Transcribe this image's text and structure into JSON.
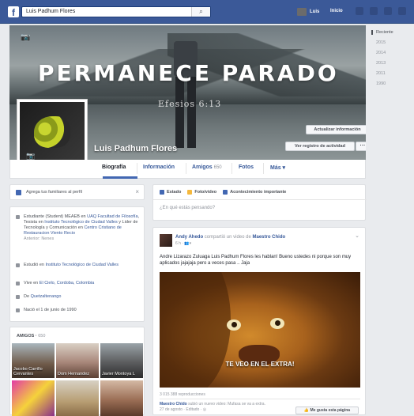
{
  "topbar": {
    "search_value": "Luis Padhum Flores",
    "user_name": "Luis",
    "home_label": "Inicio"
  },
  "cover": {
    "title": "PERMANECE PARADO",
    "subtitle": "Efesios 6:13",
    "update_info": "Actualizar información",
    "activity_log": "Ver registro de actividad",
    "more": "···"
  },
  "profile": {
    "name": "Luis Padhum Flores"
  },
  "nav": {
    "biografia": "Biografía",
    "informacion": "Información",
    "amigos": "Amigos",
    "amigos_count": "650",
    "fotos": "Fotos",
    "mas": "Más ▾"
  },
  "years": [
    "Reciente",
    "2015",
    "2014",
    "2013",
    "2011",
    "1990"
  ],
  "add_family": {
    "label": "Agrega tus familiares al perfil"
  },
  "intro": {
    "work": {
      "prefix": "Estudiante (Student) MEAEB en ",
      "link1": "UAQ Facultad de Filosofía",
      "mid": ", Tesista en ",
      "link2": "Instituto Tecnológico de Ciudad Valles",
      "mid2": " y Lider de Tecnología y Comunicación en ",
      "link3": "Centro Cristiano de Restauracion Viento Recio",
      "previous": "Anterior: Nenes"
    },
    "study": {
      "prefix": "Estudió en ",
      "link": "Instituto Tecnológico de Ciudad Valles"
    },
    "lives": {
      "prefix": "Vive en ",
      "link": "El Cielo, Cordoba, Colombia"
    },
    "from": {
      "prefix": "De ",
      "link": "Quetzaltenango"
    },
    "born": "Nació el 1 de junio de 1990"
  },
  "friends": {
    "title": "AMIGOS",
    "count": "650",
    "items": [
      {
        "name": "Jacobo Carrillo Cervantes"
      },
      {
        "name": "Dom Hernandez"
      },
      {
        "name": "Javier Montoya L"
      }
    ]
  },
  "composer": {
    "tab_status": "Estado",
    "tab_photo": "Foto/video",
    "tab_event": "Acontecimiento importante",
    "placeholder": "¿En qué estás pensando?"
  },
  "post": {
    "author": "Andy Ahedo",
    "action": " compartió un video de ",
    "page": "Maestro Chido",
    "meta": "6 h · ",
    "text": "Andre Lizarazo Zuluaga Luis Padhum Flores les hablan! Bueno ustedes ni porque son muy aplicados jajajaja pero a veces pasa .. Jaja",
    "video_caption": "TE VEO EN EL EXTRA!",
    "views": "3 015 388 reproducciones",
    "source_author": "Maestro Chido",
    "source_text": " subió un nuevo video: Mufasa se va a extra.",
    "source_date": "27 de agosto · Editado · ",
    "like_page": "Me gusta esta página"
  }
}
